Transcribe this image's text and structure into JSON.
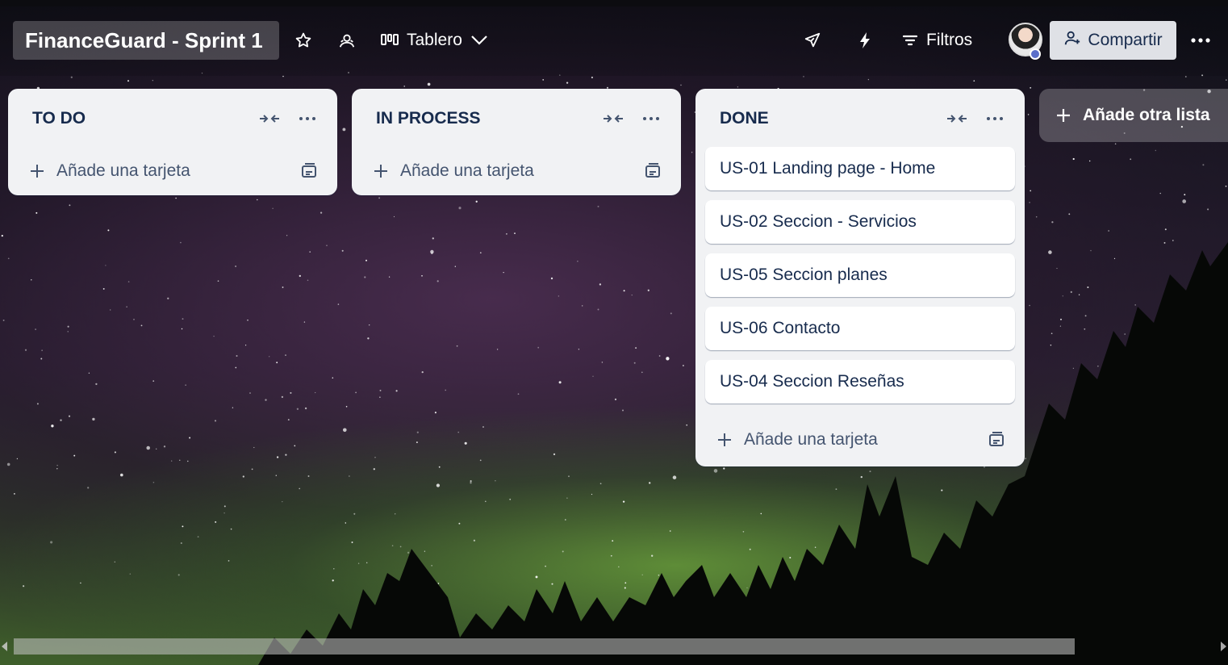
{
  "header": {
    "board_title": "FinanceGuard - Sprint 1",
    "view_label": "Tablero",
    "filters_label": "Filtros",
    "share_label": "Compartir"
  },
  "lists": [
    {
      "title": "TO DO",
      "cards": [],
      "add_card_label": "Añade una tarjeta"
    },
    {
      "title": "IN PROCESS",
      "cards": [],
      "add_card_label": "Añade una tarjeta"
    },
    {
      "title": "DONE",
      "cards": [
        "US-01 Landing page - Home",
        "US-02 Seccion - Servicios",
        "US-05 Seccion planes",
        "US-06 Contacto",
        "US-04 Seccion Reseñas"
      ],
      "add_card_label": "Añade una tarjeta"
    }
  ],
  "add_list_label": "Añade otra lista",
  "colors": {
    "list_bg": "#f1f2f4",
    "text_dark": "#172b4d",
    "text_muted": "#44546f",
    "share_bg": "#dfe1e6"
  }
}
